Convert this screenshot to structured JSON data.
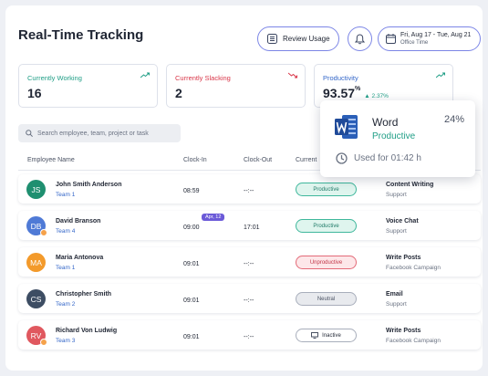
{
  "page": {
    "title": "Real-Time Tracking"
  },
  "header": {
    "review_label": "Review Usage",
    "date_range": "Fri, Aug 17 - Tue, Aug 21",
    "date_sub": "Office Time"
  },
  "stats": [
    {
      "label": "Currently Working",
      "value": "16",
      "color": "#1f9e86"
    },
    {
      "label": "Currently Slacking",
      "value": "2",
      "color": "#d93548"
    },
    {
      "label": "Productivity",
      "value": "93.57",
      "unit": "%",
      "delta": "▲ 2.37%",
      "color": "#3467c9"
    }
  ],
  "search": {
    "placeholder": "Search employee, team, project or task"
  },
  "table": {
    "columns": [
      "Employee Name",
      "Clock-In",
      "Clock-Out",
      "Current"
    ],
    "rows": [
      {
        "initials": "JS",
        "avatar_color": "#1f8f70",
        "name": "John Smith Anderson",
        "team": "Team 1",
        "clock_in": "08:59",
        "clock_out": "--:--",
        "status": "Productive",
        "activity": "Content Writing",
        "activity_sub": "Support"
      },
      {
        "initials": "DB",
        "avatar_color": "#4f7ad6",
        "name": "David Branson",
        "team": "Team 4",
        "clock_in": "09:00",
        "badge": "Apr, 12",
        "clock_out": "17:01",
        "status": "Productive",
        "activity": "Voice Chat",
        "activity_sub": "Support"
      },
      {
        "initials": "MA",
        "avatar_color": "#f39a2b",
        "name": "Maria Antonova",
        "team": "Team 1",
        "clock_in": "09:01",
        "clock_out": "--:--",
        "status": "Unproductive",
        "activity": "Write Posts",
        "activity_sub": "Facebook Campaign"
      },
      {
        "initials": "CS",
        "avatar_color": "#3d4d63",
        "name": "Christopher Smith",
        "team": "Team 2",
        "clock_in": "09:01",
        "clock_out": "--:--",
        "status": "Neutral",
        "activity": "Email",
        "activity_sub": "Support"
      },
      {
        "initials": "RV",
        "avatar_color": "#e0585f",
        "name": "Richard Von Ludwig",
        "team": "Team 3",
        "clock_in": "09:01",
        "clock_out": "--:--",
        "status": "Inactive",
        "activity": "Write Posts",
        "activity_sub": "Facebook Campaign"
      }
    ]
  },
  "popup": {
    "app": "Word",
    "status": "Productive",
    "percent": "24%",
    "used": "Used for 01:42 h",
    "icon": "word-icon"
  },
  "colors": {
    "accent": "#7c86e6",
    "productive": "#1f9e86",
    "unproductive": "#d93548",
    "link": "#3467c9"
  }
}
